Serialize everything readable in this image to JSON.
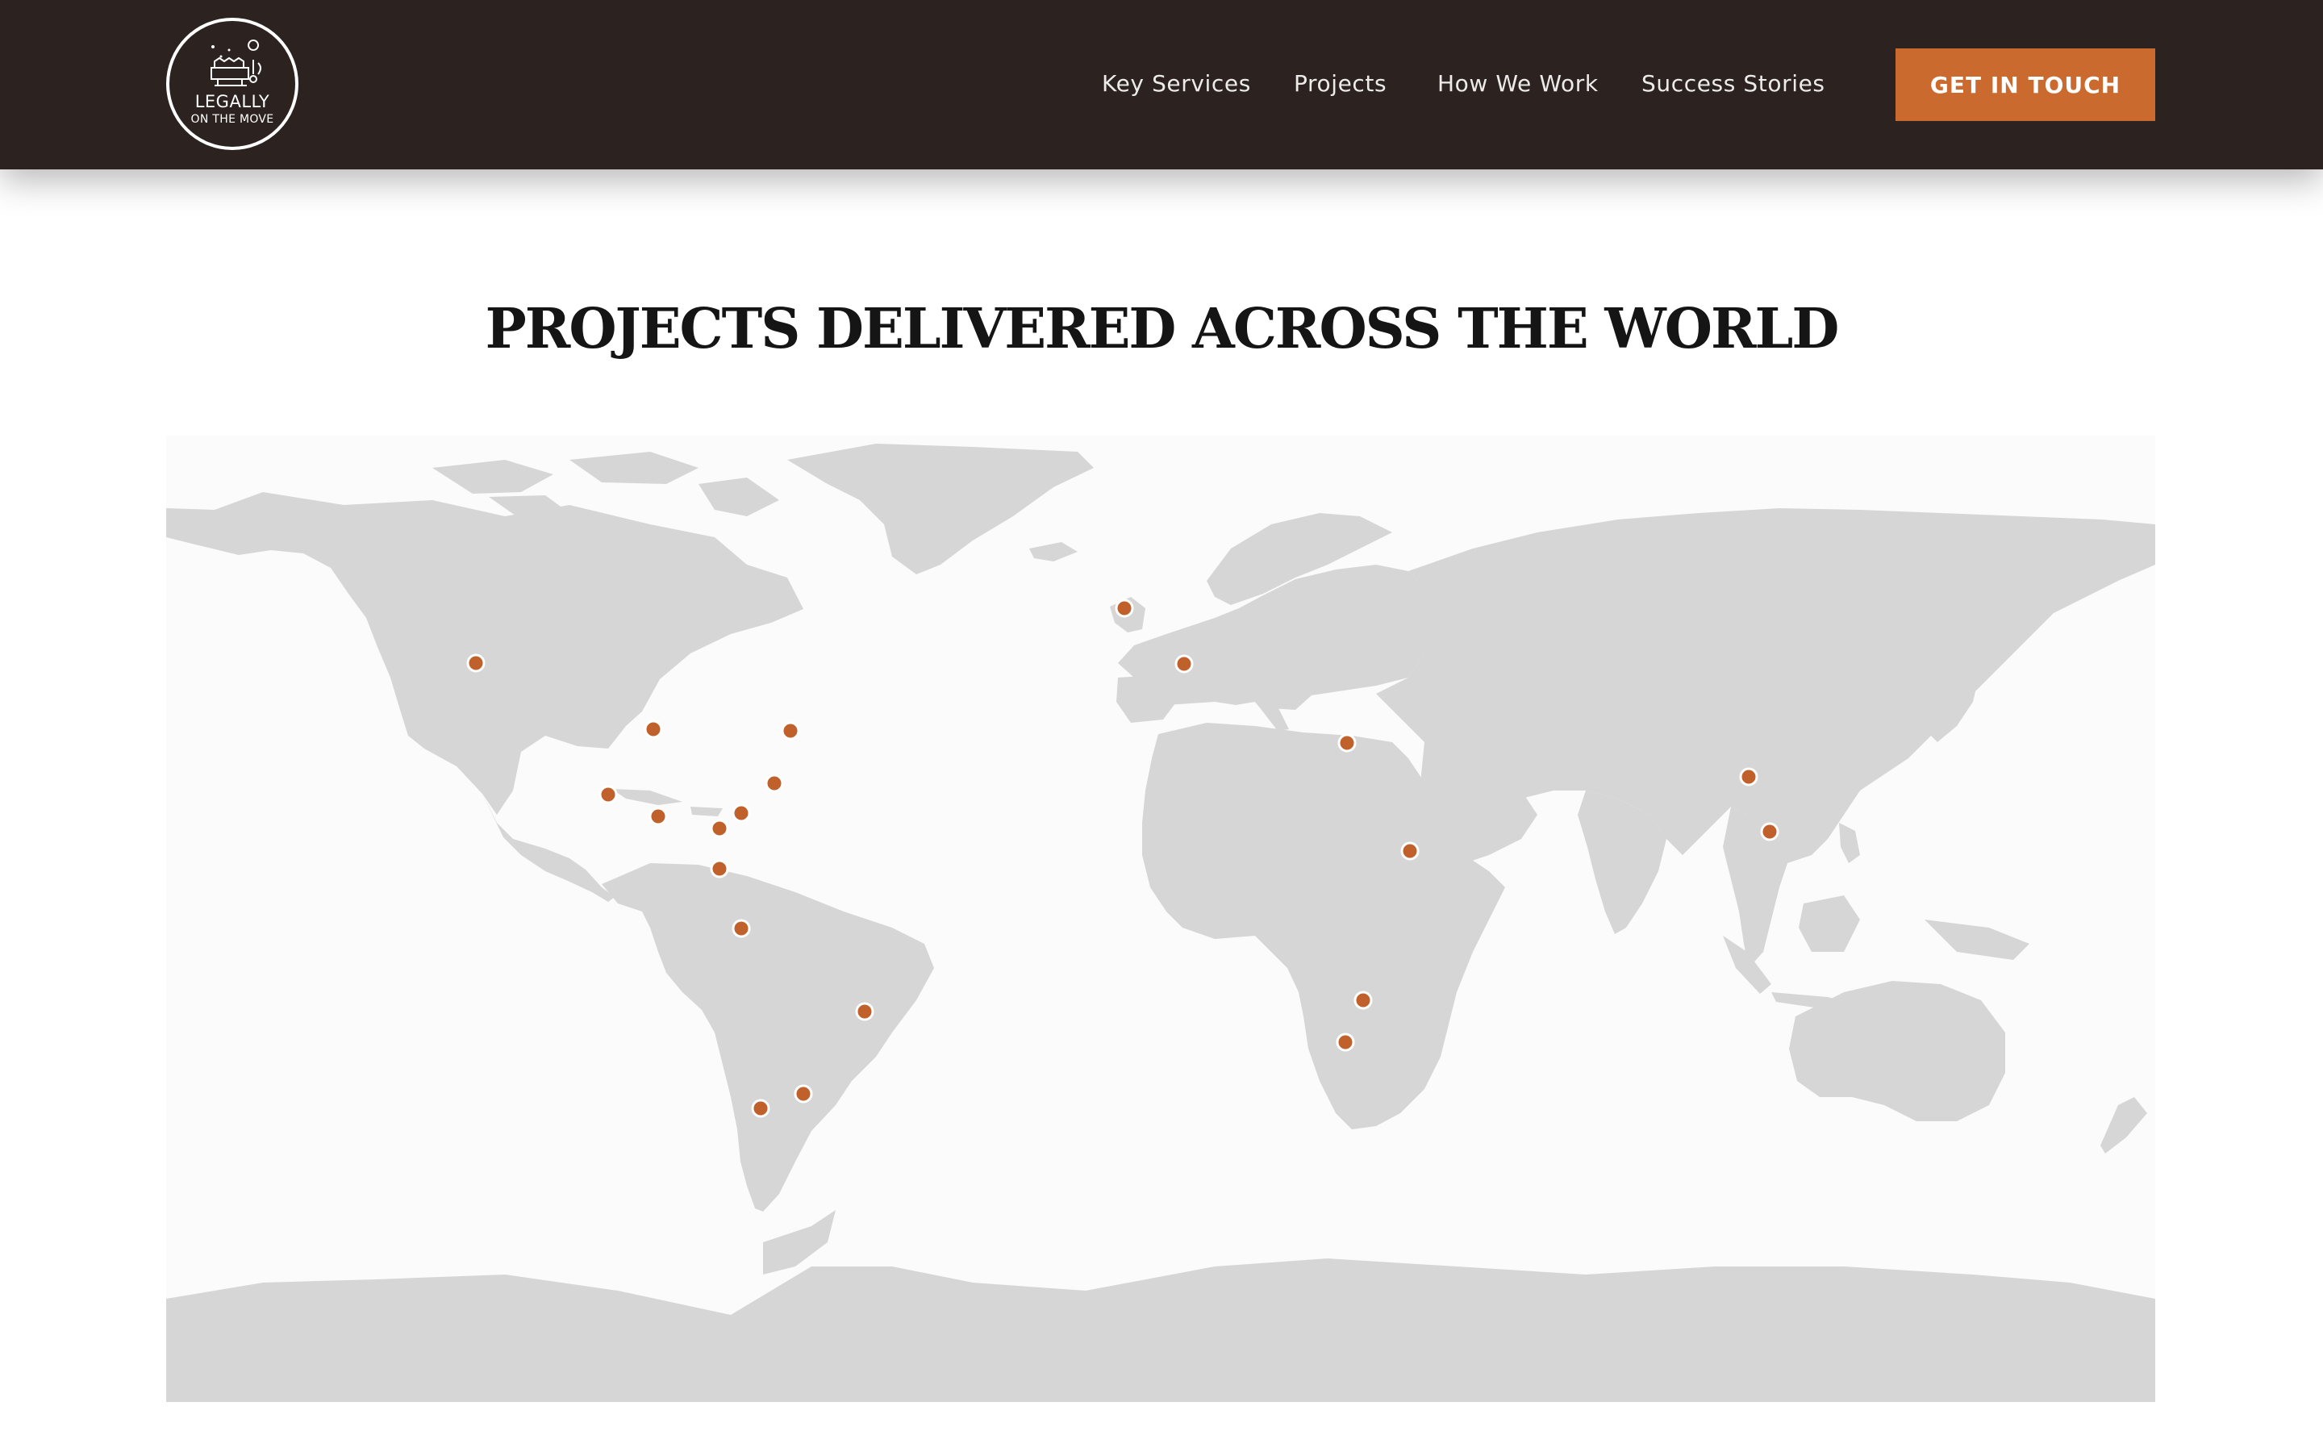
{
  "header": {
    "logo": {
      "line1": "LEGALLY",
      "line2": "ON THE MOVE"
    },
    "nav_items": [
      "Key Services",
      "Projects",
      "How We Work",
      "Success Stories"
    ],
    "cta_label": "GET IN TOUCH"
  },
  "main": {
    "title": "PROJECTS DELIVERED ACROSS THE WORLD"
  },
  "colors": {
    "nav_bg": "#2c221f",
    "accent": "#cb6a2f",
    "land": "#d6d6d6",
    "marker": "#c0612c"
  },
  "icons": [
    "logo-emblem-icon",
    "map-pin-icon"
  ]
}
